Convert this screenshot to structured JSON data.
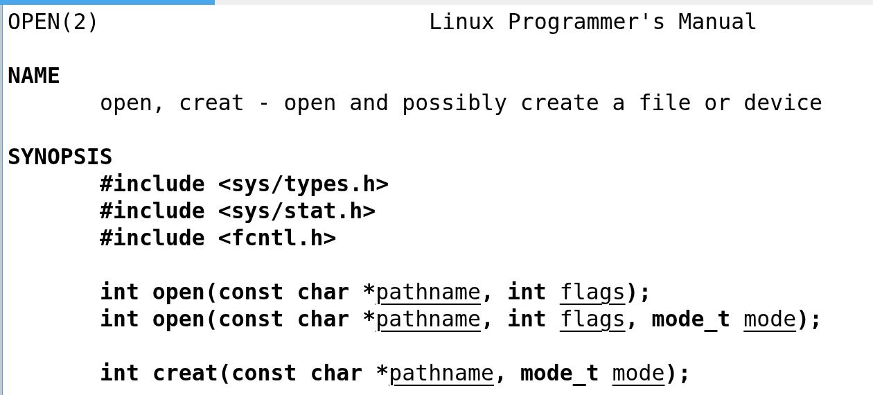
{
  "header": {
    "left": "OPEN(2)",
    "center": "Linux Programmer's Manual"
  },
  "sections": [
    {
      "heading": "NAME",
      "blocks": [
        [
          [
            {
              "text": "open, creat - open and possibly create a file or device",
              "kind": "plain"
            }
          ]
        ]
      ]
    },
    {
      "heading": "SYNOPSIS",
      "blocks": [
        [
          [
            {
              "text": "#include <sys/types.h>",
              "kind": "bold"
            }
          ],
          [
            {
              "text": "#include <sys/stat.h>",
              "kind": "bold"
            }
          ],
          [
            {
              "text": "#include <fcntl.h>",
              "kind": "bold"
            }
          ]
        ],
        [
          [
            {
              "text": "int open(const char *",
              "kind": "bold"
            },
            {
              "text": "pathname",
              "kind": "argument"
            },
            {
              "text": ", int ",
              "kind": "bold"
            },
            {
              "text": "flags",
              "kind": "argument"
            },
            {
              "text": ");",
              "kind": "bold"
            }
          ],
          [
            {
              "text": "int open(const char *",
              "kind": "bold"
            },
            {
              "text": "pathname",
              "kind": "argument"
            },
            {
              "text": ", int ",
              "kind": "bold"
            },
            {
              "text": "flags",
              "kind": "argument"
            },
            {
              "text": ", mode_t ",
              "kind": "bold"
            },
            {
              "text": "mode",
              "kind": "argument"
            },
            {
              "text": ");",
              "kind": "bold"
            }
          ]
        ],
        [
          [
            {
              "text": "int creat(const char *",
              "kind": "bold"
            },
            {
              "text": "pathname",
              "kind": "argument"
            },
            {
              "text": ", mode_t ",
              "kind": "bold"
            },
            {
              "text": "mode",
              "kind": "argument"
            },
            {
              "text": ");",
              "kind": "bold"
            }
          ]
        ]
      ]
    }
  ]
}
